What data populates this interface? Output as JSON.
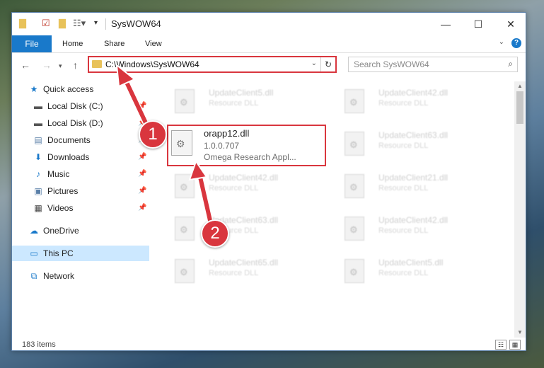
{
  "window": {
    "title": "SysWOW64",
    "controls": {
      "minimize": "—",
      "maximize": "☐",
      "close": "✕"
    }
  },
  "ribbon": {
    "file_label": "File",
    "tabs": [
      "Home",
      "Share",
      "View"
    ],
    "expand_glyph": "⌄",
    "help_glyph": "?"
  },
  "address": {
    "path": "C:\\Windows\\SysWOW64",
    "search_placeholder": "Search SysWOW64"
  },
  "nav_pane": {
    "items": [
      {
        "label": "Quick access",
        "icon": "star-icon",
        "glyph": "★",
        "pinned": false
      },
      {
        "label": "Local Disk (C:)",
        "icon": "drive-icon",
        "glyph": "▬",
        "pinned": true
      },
      {
        "label": "Local Disk (D:)",
        "icon": "drive-icon",
        "glyph": "▬",
        "pinned": true
      },
      {
        "label": "Documents",
        "icon": "documents-icon",
        "glyph": "▤",
        "pinned": true
      },
      {
        "label": "Downloads",
        "icon": "download-icon",
        "glyph": "⬇",
        "pinned": true
      },
      {
        "label": "Music",
        "icon": "music-icon",
        "glyph": "♪",
        "pinned": true
      },
      {
        "label": "Pictures",
        "icon": "pictures-icon",
        "glyph": "▣",
        "pinned": true
      },
      {
        "label": "Videos",
        "icon": "videos-icon",
        "glyph": "▦",
        "pinned": true
      },
      {
        "label": "OneDrive",
        "icon": "cloud-icon",
        "glyph": "☁",
        "pinned": false
      },
      {
        "label": "This PC",
        "icon": "computer-icon",
        "glyph": "▭",
        "pinned": false,
        "selected": true
      },
      {
        "label": "Network",
        "icon": "network-icon",
        "glyph": "⧉",
        "pinned": false
      }
    ]
  },
  "files": [
    {
      "name": "UpdateClient5.dll",
      "type": "Resource DLL"
    },
    {
      "name": "UpdateClient42.dll",
      "type": "Resource DLL"
    },
    {
      "name": "UpdateClient63.dll",
      "type": "Resource DLL"
    },
    {
      "name": "UpdateClient42.dll",
      "type": "Resource DLL"
    },
    {
      "name": "UpdateClient21.dll",
      "type": "Resource DLL"
    },
    {
      "name": "UpdateClient63.dll",
      "type": "Resource DLL"
    },
    {
      "name": "UpdateClient42.dll",
      "type": "Resource DLL"
    },
    {
      "name": "UpdateClient65.dll",
      "type": "Resource DLL"
    },
    {
      "name": "UpdateClient5.dll",
      "type": "Resource DLL"
    }
  ],
  "highlighted_file": {
    "name": "orapp12.dll",
    "version": "1.0.0.707",
    "description": "Omega Research Appl..."
  },
  "status": {
    "item_count": "183 items"
  },
  "annotations": {
    "step1": "1",
    "step2": "2",
    "color": "#d9363e"
  }
}
